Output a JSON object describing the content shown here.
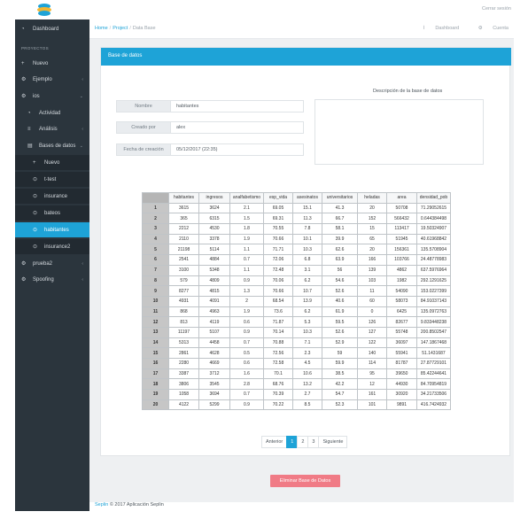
{
  "header": {
    "logout": "Cerrar sesión",
    "links": {
      "dashboard": "Dashboard",
      "account": "Cuenta"
    }
  },
  "breadcrumb": {
    "home": "Home",
    "project": "Project",
    "current": "Data Base",
    "separator": "/"
  },
  "sidebar": {
    "dashboard": "Dashboard",
    "section_title": "PROYECTOS",
    "items": [
      {
        "label": "Nuevo",
        "icon": "plus-icon"
      },
      {
        "label": "Ejemplo",
        "icon": "gear-icon"
      },
      {
        "label": "ios",
        "icon": "gear-icon"
      },
      {
        "label": "Actividad",
        "icon": "activity-icon"
      },
      {
        "label": "Análisis",
        "icon": "list-icon"
      },
      {
        "label": "Bases de datos",
        "icon": "database-icon"
      },
      {
        "label": "Nuevo",
        "icon": "plus-icon"
      },
      {
        "label": "t-test",
        "icon": "gear-icon"
      },
      {
        "label": "insurance",
        "icon": "gear-icon"
      },
      {
        "label": "bateos",
        "icon": "gear-icon"
      },
      {
        "label": "habitantes",
        "icon": "gear-icon"
      },
      {
        "label": "insurance2",
        "icon": "gear-icon"
      },
      {
        "label": "prueba2",
        "icon": "gear-icon"
      },
      {
        "label": "Spoofing",
        "icon": "gear-icon"
      }
    ]
  },
  "card": {
    "title": "Base de datos",
    "fields": {
      "name_label": "Nombre",
      "name_value": "habitantes",
      "creator_label": "Creado por",
      "creator_value": "alex",
      "date_label": "Fecha de creación",
      "date_value": "05/12/2017 (22:35)"
    },
    "description_label": "Descripción de la base de datos",
    "description_value": ""
  },
  "table": {
    "columns": [
      "habitantes",
      "ingresos",
      "analfabetismo",
      "esp_vida",
      "asesinatos",
      "universitarios",
      "heladas",
      "area",
      "densidad_pob"
    ],
    "rows": [
      [
        "1",
        "3615",
        "3624",
        "2.1",
        "69.05",
        "15.1",
        "41.3",
        "20",
        "50708",
        "71.29052615"
      ],
      [
        "2",
        "365",
        "6315",
        "1.5",
        "69.31",
        "11.3",
        "66.7",
        "152",
        "566432",
        "0.644384498"
      ],
      [
        "3",
        "2212",
        "4530",
        "1.8",
        "70.55",
        "7.8",
        "58.1",
        "15",
        "113417",
        "19.50324907"
      ],
      [
        "4",
        "2110",
        "3378",
        "1.9",
        "70.66",
        "10.1",
        "39.9",
        "65",
        "51945",
        "40.61968842"
      ],
      [
        "5",
        "21198",
        "5114",
        "1.1",
        "71.71",
        "10.3",
        "62.6",
        "20",
        "156361",
        "135.5708904"
      ],
      [
        "6",
        "2541",
        "4884",
        "0.7",
        "72.06",
        "6.8",
        "63.9",
        "166",
        "103766",
        "24.48778983"
      ],
      [
        "7",
        "3100",
        "5348",
        "1.1",
        "72.48",
        "3.1",
        "56",
        "139",
        "4862",
        "637.5976964"
      ],
      [
        "8",
        "579",
        "4809",
        "0.9",
        "70.06",
        "6.2",
        "54.6",
        "103",
        "1982",
        "292.1291625"
      ],
      [
        "9",
        "8277",
        "4815",
        "1.3",
        "70.66",
        "10.7",
        "52.6",
        "11",
        "54090",
        "153.0227399"
      ],
      [
        "10",
        "4931",
        "4091",
        "2",
        "68.54",
        "13.9",
        "40.6",
        "60",
        "58073",
        "84.91037143"
      ],
      [
        "11",
        "868",
        "4963",
        "1.9",
        "73.6",
        "6.2",
        "61.9",
        "0",
        "6425",
        "135.0972763"
      ],
      [
        "12",
        "813",
        "4119",
        "0.6",
        "71.87",
        "5.3",
        "59.5",
        "126",
        "82677",
        "9.833448238"
      ],
      [
        "13",
        "11197",
        "5107",
        "0.9",
        "70.14",
        "10.3",
        "52.6",
        "127",
        "55748",
        "200.8502547"
      ],
      [
        "14",
        "5313",
        "4458",
        "0.7",
        "70.88",
        "7.1",
        "52.9",
        "122",
        "36097",
        "147.1867468"
      ],
      [
        "15",
        "2861",
        "4628",
        "0.5",
        "72.56",
        "2.3",
        "59",
        "140",
        "55941",
        "51.1431687"
      ],
      [
        "16",
        "2280",
        "4669",
        "0.6",
        "72.58",
        "4.5",
        "59.9",
        "114",
        "81787",
        "27.87729101"
      ],
      [
        "17",
        "3387",
        "3712",
        "1.6",
        "70.1",
        "10.6",
        "38.5",
        "95",
        "39650",
        "85.42244641"
      ],
      [
        "18",
        "3806",
        "3545",
        "2.8",
        "68.76",
        "13.2",
        "42.2",
        "12",
        "44930",
        "84.70954819"
      ],
      [
        "19",
        "1058",
        "3694",
        "0.7",
        "70.39",
        "2.7",
        "54.7",
        "161",
        "30920",
        "34.21733506"
      ],
      [
        "20",
        "4122",
        "5299",
        "0.9",
        "70.22",
        "8.5",
        "52.3",
        "101",
        "9891",
        "416.7424932"
      ]
    ]
  },
  "pagination": {
    "prev": "Anterior",
    "pages": [
      "1",
      "2",
      "3"
    ],
    "active_page": "1",
    "next": "Siguiente"
  },
  "actions": {
    "delete": "Eliminar Base de Datos"
  },
  "footer": {
    "brand": "Seplin",
    "text": "© 2017 Aplicación Seplin"
  },
  "colors": {
    "accent": "#1ea3d7",
    "sidebar": "#2b353d",
    "danger": "#f07b86"
  }
}
